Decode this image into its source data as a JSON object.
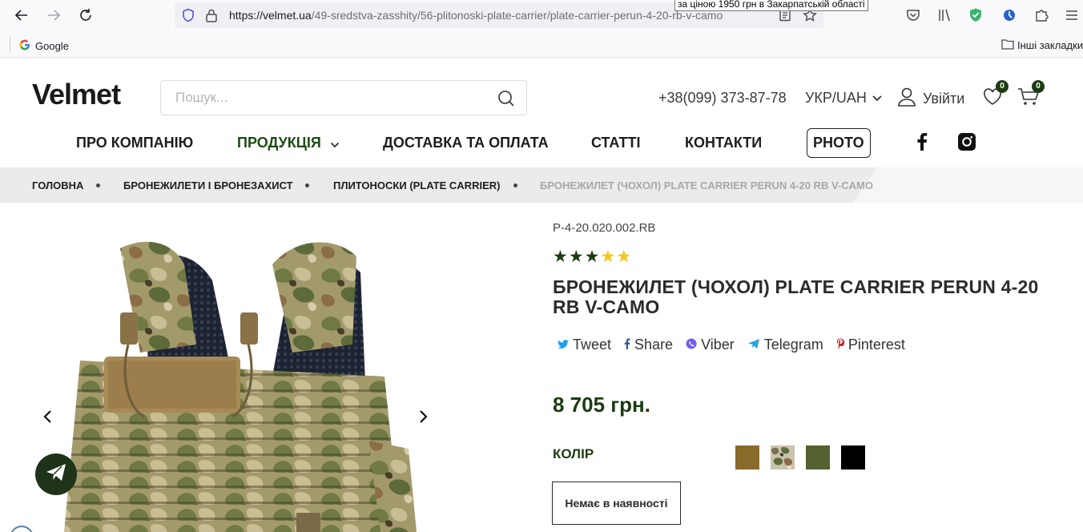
{
  "browser": {
    "url_host": "https://velmet.ua",
    "url_path": "/49-sredstva-zasshity/56-plitonoski-plate-carrier/plate-carrier-perun-4-20-rb-v-camo",
    "tooltip": "за ціною 1950 грн в Закарпатській області",
    "bookmark_google": "Google",
    "bookmark_other": "Інші закладки"
  },
  "header": {
    "logo": "Velmet",
    "search_placeholder": "Пошук...",
    "phone": "+38(099) 373-87-78",
    "language": "УКР/UAH",
    "login": "Увійти",
    "wishlist_count": "0",
    "cart_count": "0"
  },
  "nav": {
    "about": "ПРО КОМПАНІЮ",
    "products": "ПРОДУКЦІЯ",
    "delivery": "ДОСТАВКА ТА ОПЛАТА",
    "articles": "СТАТТІ",
    "contacts": "КОНТАКТИ",
    "photo": "PHOTO"
  },
  "breadcrumbs": [
    "ГОЛОВНА",
    "БРОНЕЖИЛЕТИ І БРОНЕЗАХИСТ",
    "ПЛИТОНОСКИ (PLATE CARRIER)",
    "БРОНЕЖИЛЕТ (ЧОХОЛ) PLATE CARRIER PERUN 4-20 RB V-CAMO"
  ],
  "product": {
    "sku": "P-4-20.020.002.RB",
    "rating": 3,
    "rating_max": 5,
    "title": "БРОНЕЖИЛЕТ (ЧОХОЛ) PLATE CARRIER PERUN 4-20 RB V-CAMO",
    "share": {
      "tweet": "Tweet",
      "share": "Share",
      "viber": "Viber",
      "telegram": "Telegram",
      "pinterest": "Pinterest"
    },
    "price": "8 705 грн.",
    "color_label": "КОЛІР",
    "stock_status": "Немає в наявності"
  },
  "colors": {
    "star_filled": "#1c3b12",
    "star_empty": "#f5c518",
    "accent_green": "#1c3b12",
    "swatches": [
      "#8a6a2a",
      "camo",
      "#556130",
      "#000000"
    ]
  }
}
